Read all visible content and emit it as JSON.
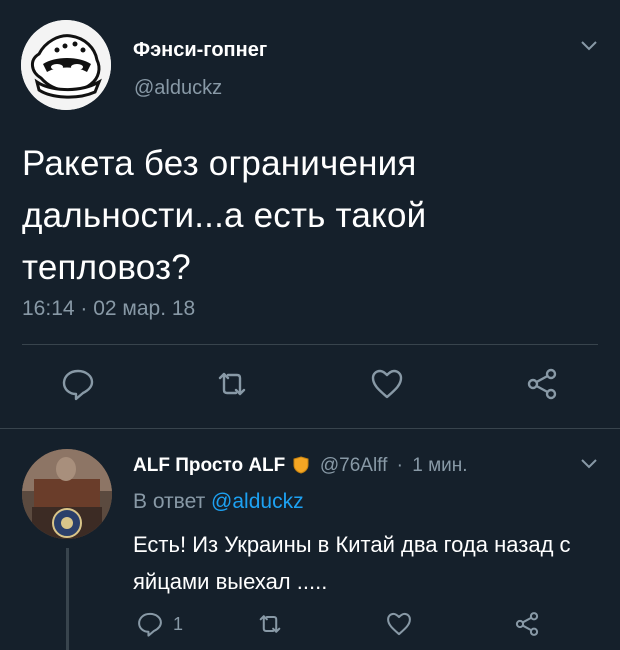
{
  "main_tweet": {
    "display_name": "Фэнси-гопнег",
    "handle": "@alduckz",
    "text": "Ракета без ограничения дальности...а есть такой тепловоз?",
    "timestamp": "16:14 · 02 мар. 18",
    "actions": [
      "reply-icon",
      "retweet-icon",
      "like-icon",
      "share-icon"
    ]
  },
  "reply_tweet": {
    "display_name": "ALF Просто ALF",
    "badge_icon": "shield-icon",
    "handle": "@76Alff",
    "time_sep": "·",
    "time": "1 мин.",
    "reply_prefix": "В ответ",
    "reply_to": "@alduckz",
    "text": "Есть! Из Украины в Китай два года назад с яйцами выехал .....",
    "reply_count": "1"
  },
  "colors": {
    "background": "#15202b",
    "muted": "#8899a6",
    "link": "#1da1f2",
    "divider": "#38444d",
    "badge": "#f5a623"
  }
}
